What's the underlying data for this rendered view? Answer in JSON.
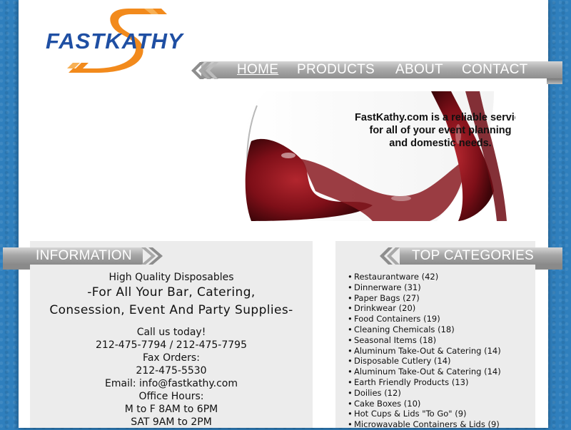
{
  "logo": {
    "text": "FASTKATHY",
    "colors": {
      "blue": "#1f4fa3",
      "orange": "#f28a1c"
    }
  },
  "nav": {
    "items": [
      "HOME",
      "PRODUCTS",
      "ABOUT",
      "CONTACT"
    ],
    "active": "HOME"
  },
  "hero": {
    "tagline": "FastKathy.com is a reliable service\nfor all of your event planning\nand domestic needs."
  },
  "info": {
    "title": "INFORMATION",
    "line1": "High Quality Disposables",
    "line2": "-For All Your Bar, Catering,",
    "line3": "Consession, Event And Party Supplies-",
    "call": "Call us today!",
    "phones": "212-475-7794 / 212-475-7795",
    "fax_label": "Fax Orders:",
    "fax": "212-475-5530",
    "email": "Email: info@fastkathy.com",
    "hours_label": "Office Hours:",
    "hours1": "M to F 8AM to 6PM",
    "hours2": "SAT 9AM to 2PM"
  },
  "categories": {
    "title": "TOP CATEGORIES",
    "items": [
      "Restaurantware (42)",
      "Dinnerware (31)",
      "Paper Bags (27)",
      "Drinkwear (20)",
      "Food Containers (19)",
      "Cleaning Chemicals (18)",
      "Seasonal Items (18)",
      "Aluminum Take-Out & Catering (14)",
      "Disposable Cutlery (14)",
      "Aluminum Take-Out & Catering (14)",
      "Earth Friendly Products (13)",
      "Doilies (12)",
      "Cake Boxes (10)",
      "Hot Cups & Lids \"To Go\" (9)",
      "Microwavable Containers & Lids (9)"
    ]
  }
}
